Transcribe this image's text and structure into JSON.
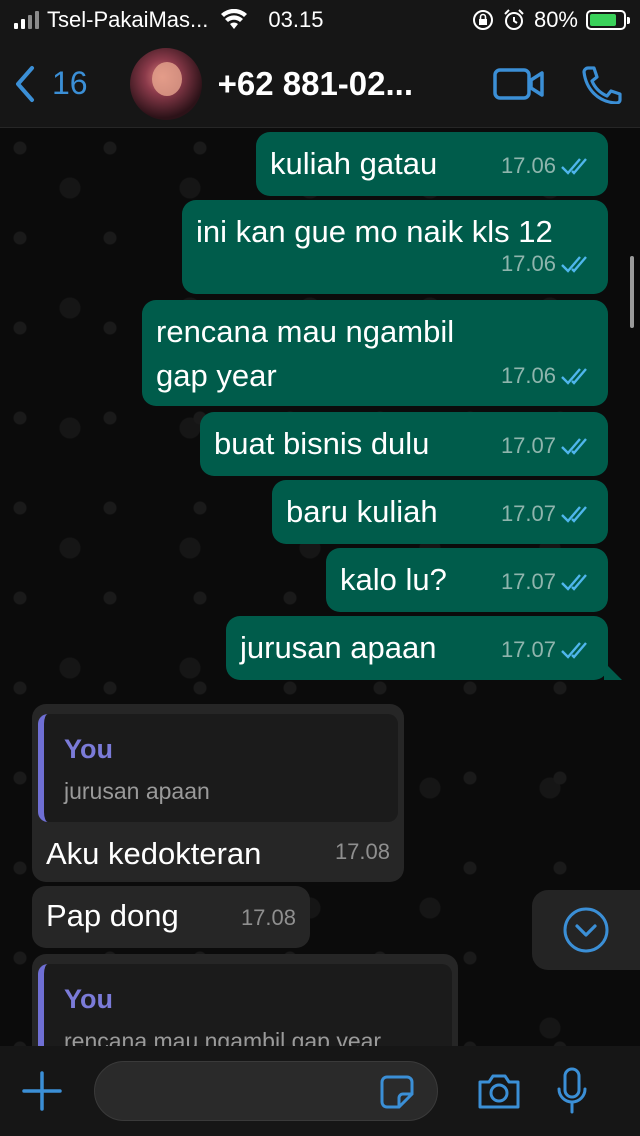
{
  "status": {
    "carrier": "Tsel-PakaiMas...",
    "time": "03.15",
    "battery": "80%",
    "battery_level": 0.8
  },
  "header": {
    "back_count": "16",
    "contact": "+62 881-02..."
  },
  "messages": [
    {
      "text": "kuliah gatau",
      "time": "17.06"
    },
    {
      "text": "ini kan gue mo naik kls 12",
      "time": "17.06"
    },
    {
      "text": "rencana mau ngambil gap year",
      "time": "17.06"
    },
    {
      "text": "buat bisnis dulu",
      "time": "17.07"
    },
    {
      "text": "baru kuliah",
      "time": "17.07"
    },
    {
      "text": "kalo lu?",
      "time": "17.07"
    },
    {
      "text": "jurusan apaan",
      "time": "17.07"
    },
    {
      "quote_author": "You",
      "quote_text": "jurusan apaan",
      "text": "Aku kedokteran",
      "time": "17.08"
    },
    {
      "text": "Pap dong",
      "time": "17.08"
    },
    {
      "quote_author": "You",
      "quote_text": "rencana mau ngambil gap year"
    }
  ],
  "colors": {
    "outgoing_bubble": "#005c4b",
    "incoming_bubble": "#262626",
    "accent": "#3b8fd6",
    "quote_author": "#7b7bd8"
  }
}
